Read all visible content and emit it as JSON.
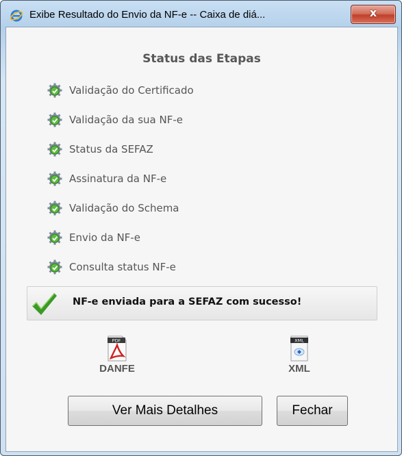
{
  "window": {
    "title": "Exibe Resultado do Envio da NF-e -- Caixa de diá...",
    "close_label": "x"
  },
  "status": {
    "heading": "Status das Etapas",
    "steps": [
      {
        "label": "Validação do Certificado",
        "state": "ok"
      },
      {
        "label": "Validação da sua NF-e",
        "state": "ok"
      },
      {
        "label": "Status da SEFAZ",
        "state": "ok"
      },
      {
        "label": "Assinatura da NF-e",
        "state": "ok"
      },
      {
        "label": "Validação do Schema",
        "state": "ok"
      },
      {
        "label": "Envio da NF-e",
        "state": "ok"
      },
      {
        "label": "Consulta status NF-e",
        "state": "ok"
      }
    ]
  },
  "result": {
    "message": "NF-e enviada para a SEFAZ com sucesso!"
  },
  "documents": {
    "danfe": {
      "label": "DANFE",
      "badge": "PDF",
      "icon": "pdf-file-icon"
    },
    "xml": {
      "label": "XML",
      "badge": "XML",
      "icon": "xml-file-icon"
    }
  },
  "buttons": {
    "details": "Ver Mais Detalhes",
    "close": "Fechar"
  },
  "colors": {
    "success_check": "#3a9a23",
    "step_gear": "#6e7f8c",
    "step_check": "#57b83a"
  }
}
